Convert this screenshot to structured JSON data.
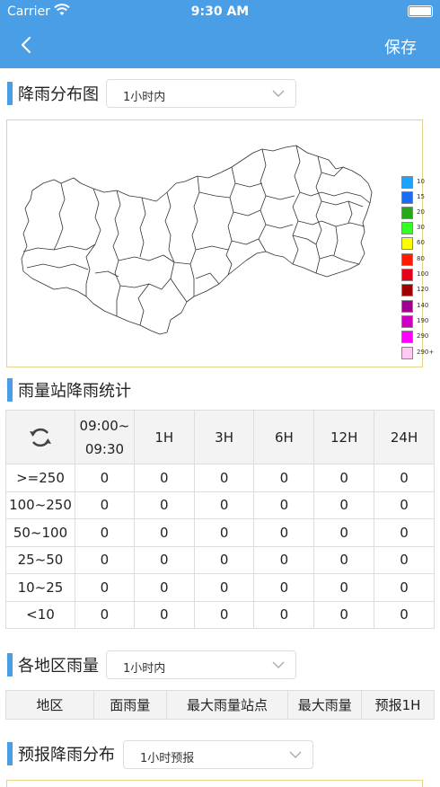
{
  "status": {
    "carrier": "Carrier",
    "time": "9:30 AM"
  },
  "nav": {
    "save_label": "保存"
  },
  "rain_map": {
    "title": "降雨分布图",
    "select_value": "1小时内"
  },
  "legend": {
    "levels": [
      {
        "label": "10",
        "color": "#1aa3ff"
      },
      {
        "label": "15",
        "color": "#1a6cf5"
      },
      {
        "label": "20",
        "color": "#26a81a"
      },
      {
        "label": "30",
        "color": "#33ff22"
      },
      {
        "label": "60",
        "color": "#ffff00"
      },
      {
        "label": "80",
        "color": "#ff1a00"
      },
      {
        "label": "100",
        "color": "#e6001a"
      },
      {
        "label": "120",
        "color": "#a10000"
      },
      {
        "label": "140",
        "color": "#a1008c"
      },
      {
        "label": "190",
        "color": "#d000c0"
      },
      {
        "label": "290",
        "color": "#ff00ff"
      },
      {
        "label": "290+",
        "color": "#ffc8f5"
      }
    ]
  },
  "station_stats": {
    "title": "雨量站降雨统计",
    "time_range_line1": "09:00~",
    "time_range_line2": "09:30",
    "columns": [
      "1H",
      "3H",
      "6H",
      "12H",
      "24H"
    ],
    "rows": [
      {
        "label": ">=250",
        "values": [
          "0",
          "0",
          "0",
          "0",
          "0",
          "0"
        ]
      },
      {
        "label": "100~250",
        "values": [
          "0",
          "0",
          "0",
          "0",
          "0",
          "0"
        ]
      },
      {
        "label": "50~100",
        "values": [
          "0",
          "0",
          "0",
          "0",
          "0",
          "0"
        ]
      },
      {
        "label": "25~50",
        "values": [
          "0",
          "0",
          "0",
          "0",
          "0",
          "0"
        ]
      },
      {
        "label": "10~25",
        "values": [
          "0",
          "0",
          "0",
          "0",
          "0",
          "0"
        ]
      },
      {
        "label": "<10",
        "values": [
          "0",
          "0",
          "0",
          "0",
          "0",
          "0"
        ]
      }
    ]
  },
  "region_rain": {
    "title": "各地区雨量",
    "select_value": "1小时内",
    "columns": [
      "地区",
      "面雨量",
      "最大雨量站点",
      "最大雨量",
      "预报1H"
    ]
  },
  "forecast": {
    "title": "预报降雨分布",
    "select_value": "1小时预报"
  }
}
